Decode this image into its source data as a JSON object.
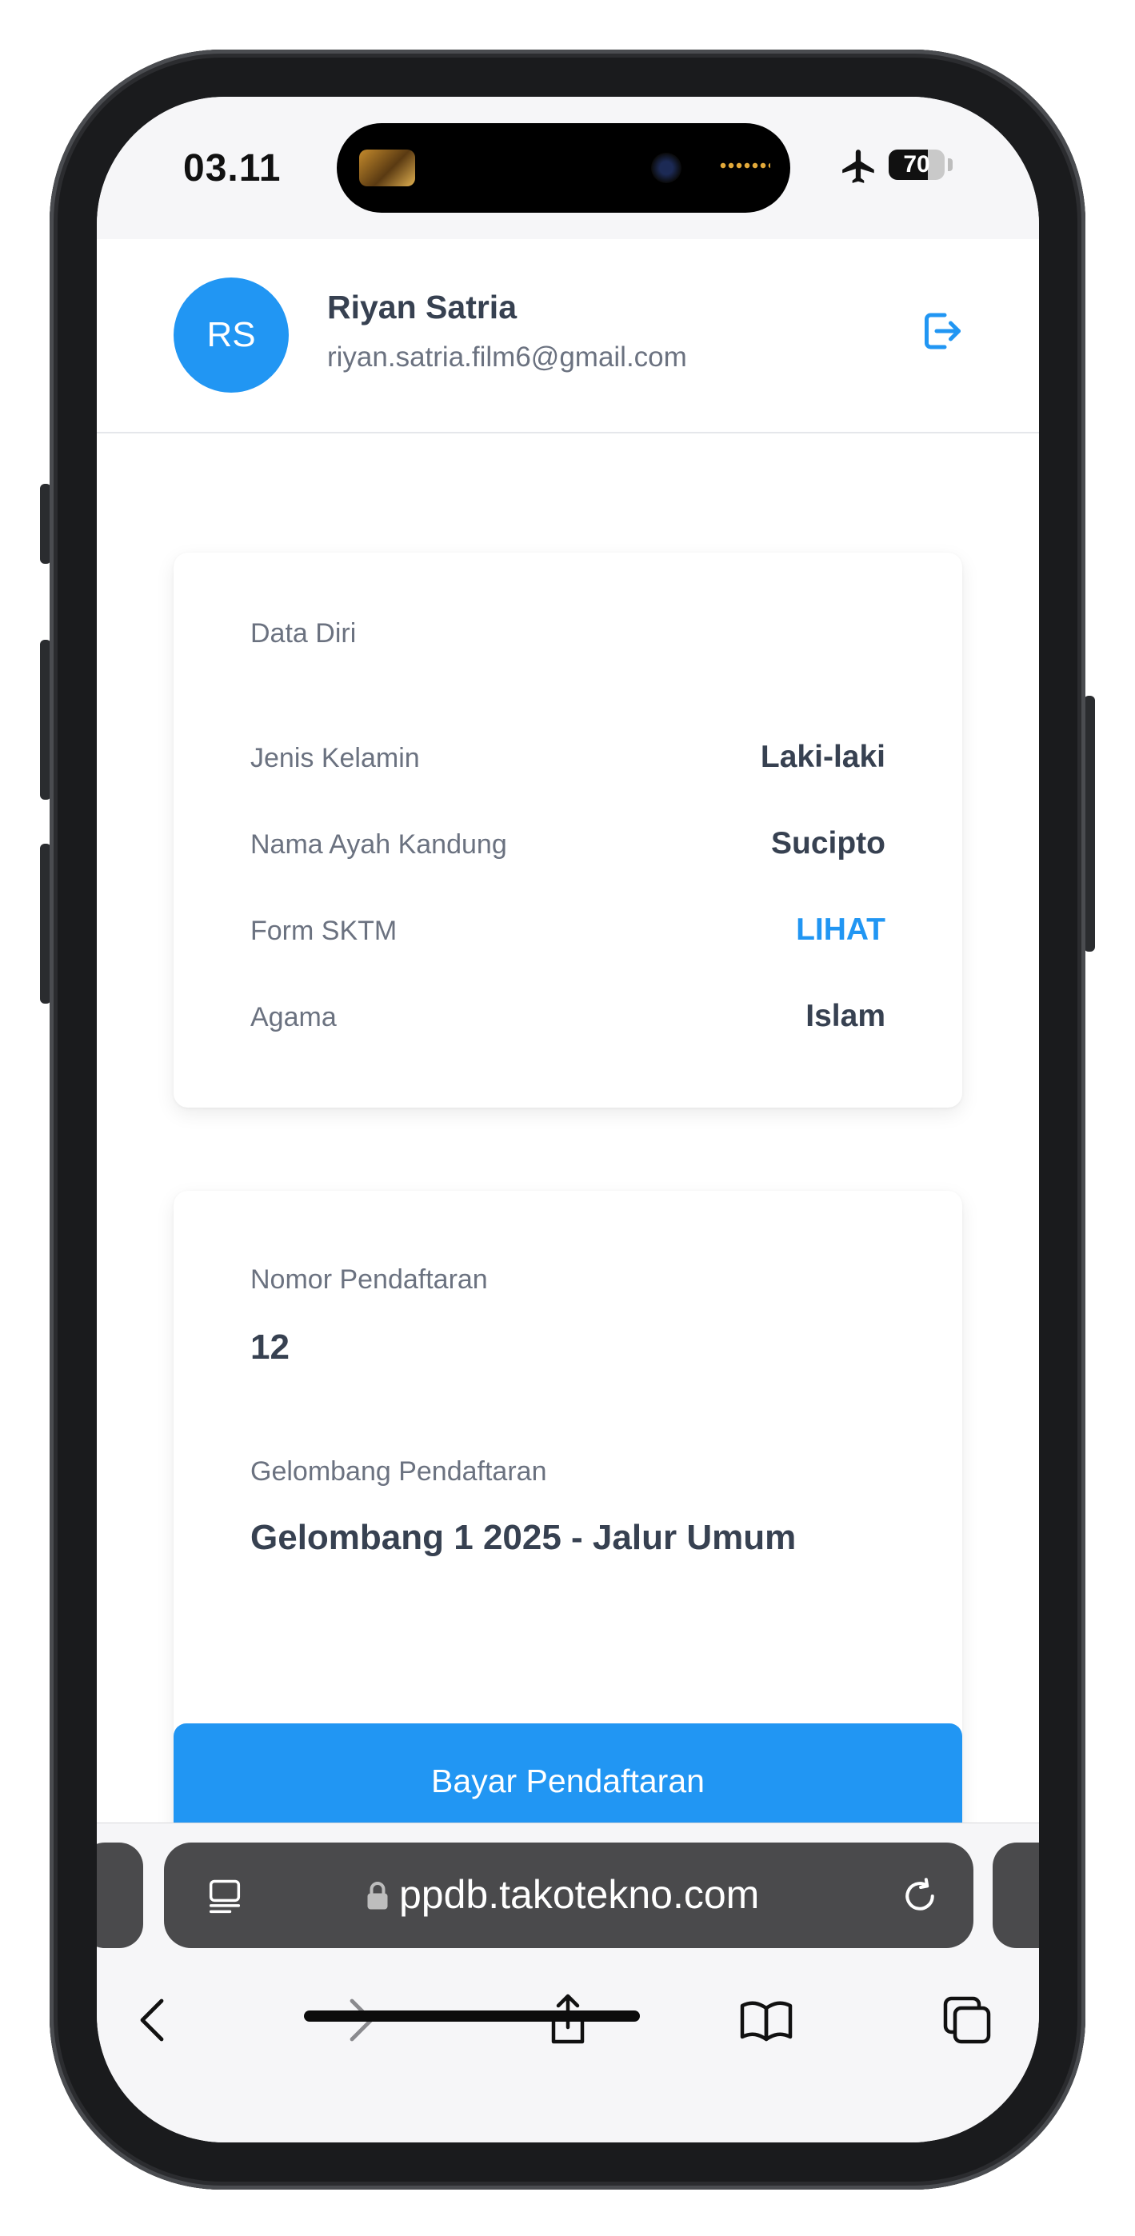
{
  "status_bar": {
    "time": "03.11",
    "battery_level": "70",
    "battery_fraction": 0.7,
    "icons": [
      "airplane-mode-icon",
      "battery-icon"
    ]
  },
  "header": {
    "avatar_initials": "RS",
    "name": "Riyan Satria",
    "email": "riyan.satria.film6@gmail.com",
    "logout_icon": "logout-icon",
    "accent_color": "#2196f3"
  },
  "personal_card": {
    "title": "Data Diri",
    "rows": [
      {
        "label": "Jenis Kelamin",
        "value": "Laki-laki"
      },
      {
        "label": "Nama Ayah Kandung",
        "value": "Sucipto"
      },
      {
        "label": "Form SKTM",
        "value": "LIHAT"
      },
      {
        "label": "Agama",
        "value": "Islam"
      }
    ]
  },
  "registration_card": {
    "number_label": "Nomor Pendaftaran",
    "number_value": "12",
    "wave_label": "Gelombang Pendaftaran",
    "wave_value": "Gelombang 1 2025 - Jalur Umum"
  },
  "pay_button": {
    "label": "Bayar Pendaftaran"
  },
  "browser": {
    "url": "ppdb.takotekno.com",
    "icons": [
      "page-menu-icon",
      "lock-icon",
      "reload-icon",
      "back-icon",
      "forward-icon",
      "share-icon",
      "bookmarks-icon",
      "tabs-icon"
    ]
  }
}
